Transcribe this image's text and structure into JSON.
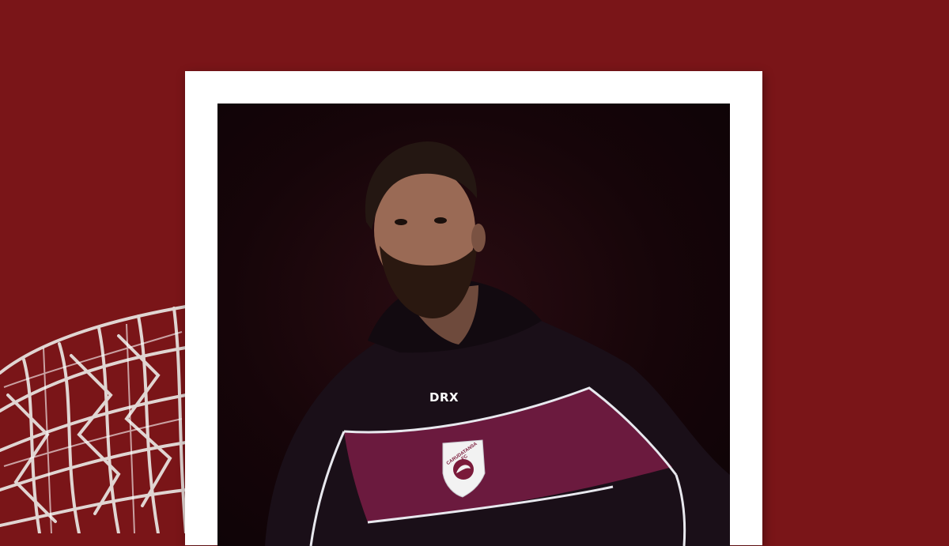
{
  "scene": {
    "background_color": "#7a1518",
    "frame_color": "#ffffff"
  },
  "photo": {
    "subject": "bearded man in a maroon and black club tracksuit top",
    "jersey_brand": "DRX",
    "crest_text": "CARUDATANSA FC",
    "colors": {
      "jersey_dark": "#1a0f18",
      "jersey_band": "#6b1a3e",
      "piping": "#e8e8ee"
    }
  }
}
